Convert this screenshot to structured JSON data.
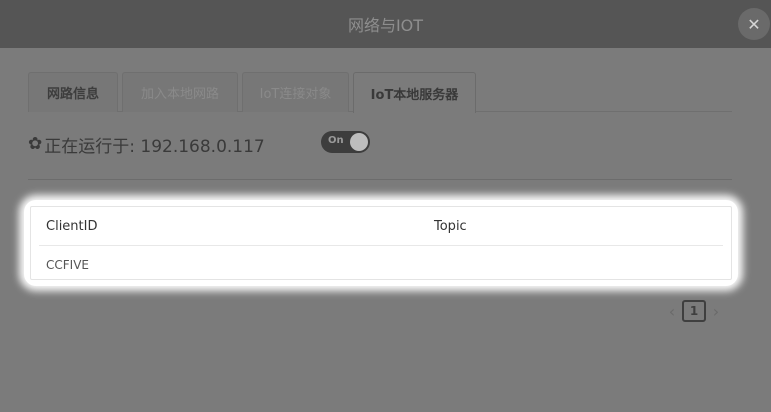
{
  "dialog": {
    "title": "网络与IOT",
    "close_icon": "close-icon"
  },
  "tabs": [
    {
      "label": "网路信息"
    },
    {
      "label": "加入本地网路"
    },
    {
      "label": "IoT连接对象"
    },
    {
      "label": "IoT本地服务器"
    }
  ],
  "status": {
    "icon": "gear-icon",
    "text": "正在运行于: 192.168.0.117",
    "toggle_label": "On"
  },
  "table": {
    "columns": [
      "ClientID",
      "Topic"
    ],
    "rows": [
      {
        "client_id": "CCFIVE",
        "topic": ""
      }
    ]
  },
  "pagination": {
    "prev": "‹",
    "current": "1",
    "next": "›"
  }
}
